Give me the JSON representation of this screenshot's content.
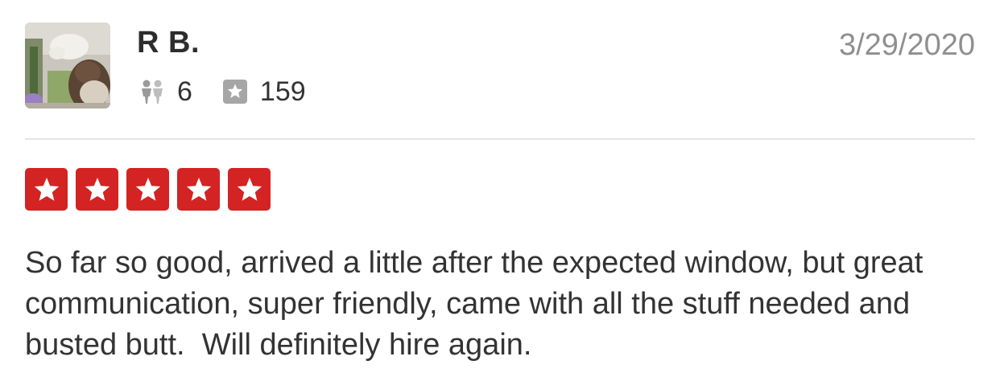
{
  "user": {
    "name": "R B.",
    "friends_count": "6",
    "reviews_count": "159",
    "avatar_icon": "user-photo-avatar",
    "friends_icon": "friends-icon",
    "reviews_icon": "review-star-icon"
  },
  "review": {
    "date": "3/29/2020",
    "rating": 5,
    "rating_max": 5,
    "text": "So far so good, arrived a little after the expected window, but great communication, super friendly, came with all the stuff needed and busted butt.  Will definitely hire again."
  },
  "colors": {
    "star_red": "#d32323",
    "date_gray": "#8f8f8f",
    "text_dark": "#333333",
    "divider": "#e6e6e6"
  }
}
